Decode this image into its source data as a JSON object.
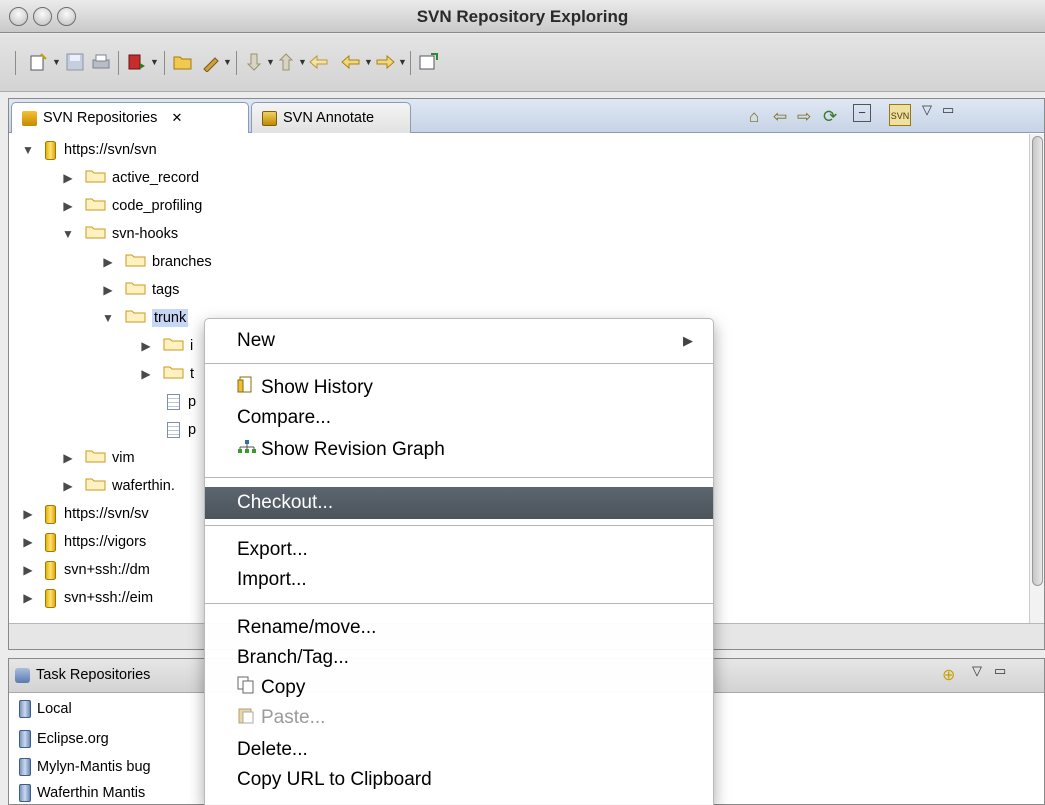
{
  "window": {
    "title": "SVN Repository Exploring"
  },
  "toolbar": {
    "icons": [
      "new-wizard-icon",
      "save-icon",
      "print-icon",
      "run-icon",
      "open-icon",
      "pen-icon",
      "next-annotation-icon",
      "previous-annotation-icon",
      "last-edit-icon",
      "back-icon",
      "forward-icon",
      "perspective-icon"
    ]
  },
  "tabs": [
    {
      "label": "SVN Repositories",
      "close": "✕"
    },
    {
      "label": "SVN Annotate"
    }
  ],
  "tree": [
    {
      "label": "https://svn/svn"
    },
    {
      "label": "active_record"
    },
    {
      "label": "code_profiling"
    },
    {
      "label": "svn-hooks"
    },
    {
      "label": "branches"
    },
    {
      "label": "tags"
    },
    {
      "label": "trunk"
    },
    {
      "label": "i"
    },
    {
      "label": "t"
    },
    {
      "label": "p"
    },
    {
      "label": "p"
    },
    {
      "label": "vim"
    },
    {
      "label": "waferthin."
    },
    {
      "label": "https://svn/sv"
    },
    {
      "label": "https://vigors"
    },
    {
      "label": "svn+ssh://dm"
    },
    {
      "label": "svn+ssh://eim"
    }
  ],
  "bottom_panel": {
    "title": "Task Repositories",
    "items": [
      "Local",
      "Eclipse.org",
      "Mylyn-Mantis bug",
      "Waferthin Mantis"
    ]
  },
  "context_menu": {
    "items": [
      {
        "label": "New"
      },
      {
        "label": "Show History"
      },
      {
        "label": "Compare..."
      },
      {
        "label": "Show Revision Graph"
      },
      {
        "label": "Checkout..."
      },
      {
        "label": "Export..."
      },
      {
        "label": "Import..."
      },
      {
        "label": "Rename/move..."
      },
      {
        "label": "Branch/Tag..."
      },
      {
        "label": "Copy"
      },
      {
        "label": "Paste..."
      },
      {
        "label": "Delete..."
      },
      {
        "label": "Copy URL to Clipboard"
      }
    ]
  },
  "colors": {
    "selection": "#c5d7f4",
    "menu_highlight": "#4f5861",
    "tab_bar": "#c7d4e6"
  }
}
